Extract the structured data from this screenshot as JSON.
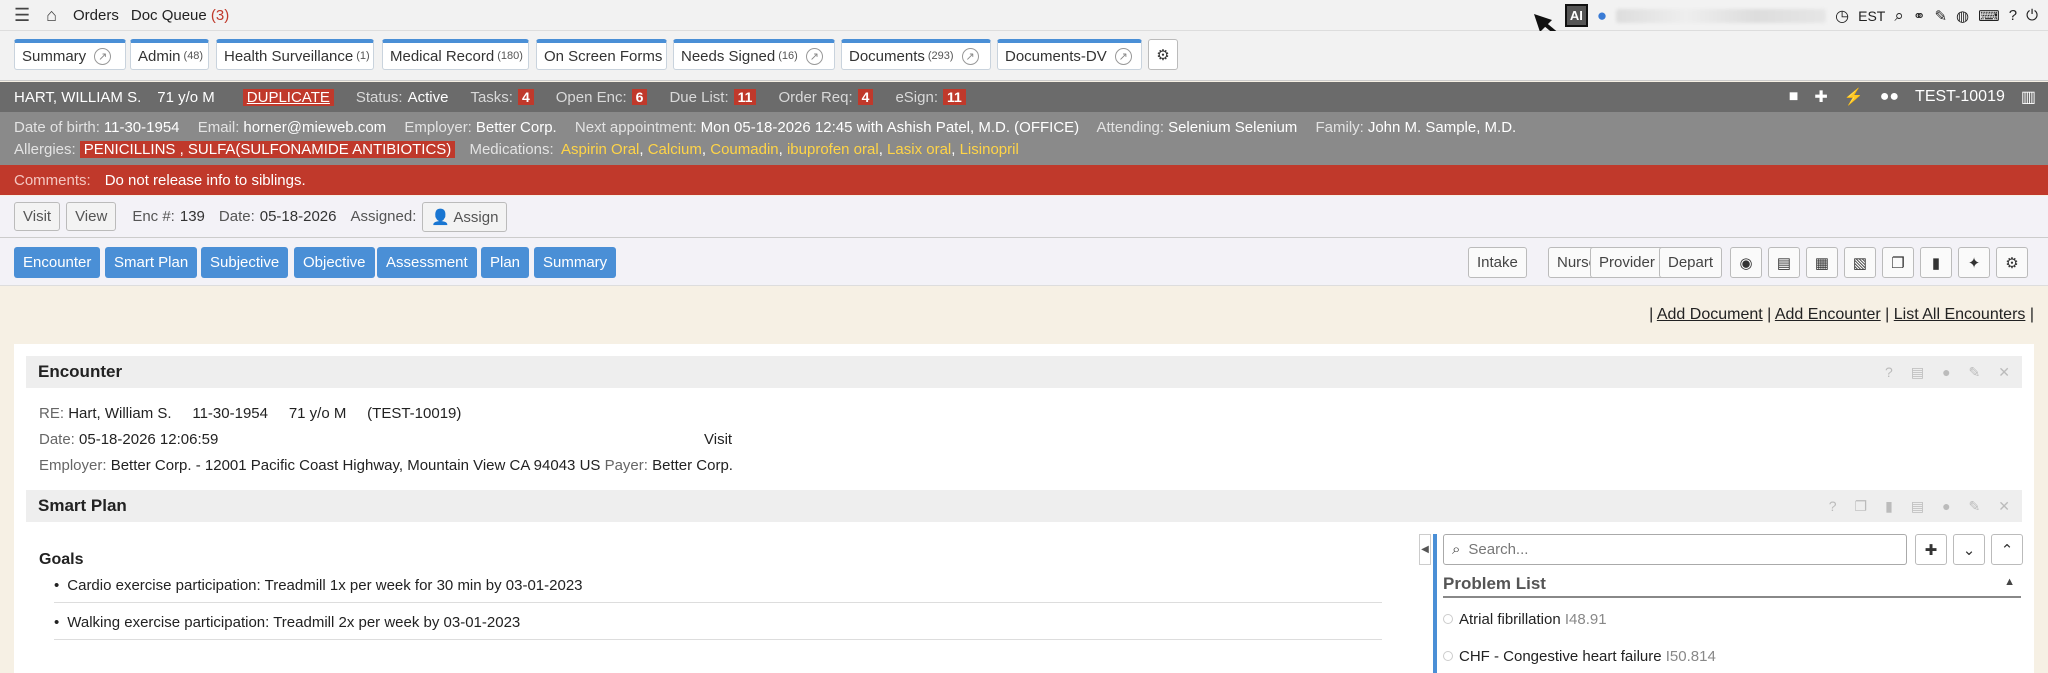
{
  "topbar": {
    "orders": "Orders",
    "doc_queue": "Doc Queue",
    "doc_queue_count": "(3)",
    "ai_label": "AI",
    "timezone": "EST"
  },
  "tabs": [
    {
      "label": "Summary",
      "count": ""
    },
    {
      "label": "Admin",
      "count": "(48)"
    },
    {
      "label": "Health Surveillance",
      "count": "(1)"
    },
    {
      "label": "Medical Record",
      "count": "(180)"
    },
    {
      "label": "On Screen Forms",
      "count": ""
    },
    {
      "label": "Needs Signed",
      "count": "(16)"
    },
    {
      "label": "Documents",
      "count": "(293)"
    },
    {
      "label": "Documents-DV",
      "count": ""
    }
  ],
  "patient": {
    "name": "HART, WILLIAM S.",
    "age": "71 y/o M",
    "duplicate": "DUPLICATE",
    "status_label": "Status:",
    "status": "Active",
    "tasks_label": "Tasks:",
    "tasks": "4",
    "open_enc_label": "Open Enc:",
    "open_enc": "6",
    "due_list_label": "Due List:",
    "due_list": "11",
    "order_req_label": "Order Req:",
    "order_req": "4",
    "esign_label": "eSign:",
    "esign": "11",
    "mrn": "TEST-10019"
  },
  "demographics": {
    "dob_label": "Date of birth:",
    "dob": "11-30-1954",
    "email_label": "Email:",
    "email": "horner@mieweb.com",
    "employer_label": "Employer:",
    "employer": "Better Corp.",
    "next_appt_label": "Next appointment:",
    "next_appt": "Mon 05-18-2026 12:45 with Ashish Patel, M.D. (OFFICE)",
    "attending_label": "Attending:",
    "attending": "Selenium Selenium",
    "family_label": "Family:",
    "family": "John M. Sample, M.D.",
    "allergies_label": "Allergies:",
    "allergies": "PENICILLINS , SULFA(SULFONAMIDE ANTIBIOTICS)",
    "medications_label": "Medications:",
    "medications": [
      "Aspirin Oral",
      "Calcium",
      "Coumadin",
      "ibuprofen oral",
      "Lasix oral",
      "Lisinopril"
    ]
  },
  "comments": {
    "label": "Comments:",
    "text": "Do not release info to siblings."
  },
  "visit": {
    "visit_btn": "Visit",
    "view_btn": "View",
    "enc_label": "Enc #:",
    "enc": "139",
    "date_label": "Date:",
    "date": "05-18-2026",
    "assigned_label": "Assigned:",
    "assign_btn": "Assign"
  },
  "nav": {
    "blue": [
      "Encounter",
      "Smart Plan",
      "Subjective",
      "Objective",
      "Assessment",
      "Plan",
      "Summary"
    ],
    "white": [
      "Intake",
      "Nurse",
      "Provider",
      "Depart"
    ]
  },
  "links": {
    "add_document": "Add Document",
    "add_encounter": "Add Encounter",
    "list_all": "List All Encounters"
  },
  "encounter": {
    "title": "Encounter",
    "re_label": "RE:",
    "re": "Hart, William S.     11-30-1954     71 y/o M     (TEST-10019)",
    "date_label": "Date:",
    "date": "05-18-2026 12:06:59",
    "visit": "Visit",
    "employer_label": "Employer:",
    "employer": "Better Corp. - 12001 Pacific Coast Highway, Mountain View CA 94043 US",
    "payer_label": "Payer:",
    "payer": "Better Corp."
  },
  "smart_plan": {
    "title": "Smart Plan",
    "goals_label": "Goals",
    "goals": [
      "Cardio exercise participation: Treadmill 1x per week for 30 min by 03-01-2023",
      "Walking exercise participation: Treadmill 2x per week by 03-01-2023"
    ]
  },
  "problem_list": {
    "search_placeholder": "Search...",
    "title": "Problem List",
    "items": [
      {
        "name": "Atrial fibrillation",
        "code": "I48.91"
      },
      {
        "name": "CHF - Congestive heart failure",
        "code": "I50.814"
      }
    ]
  },
  "colors": {
    "accent": "#4a8fd6",
    "alert": "#c0392b",
    "header": "#6b6b6b"
  }
}
